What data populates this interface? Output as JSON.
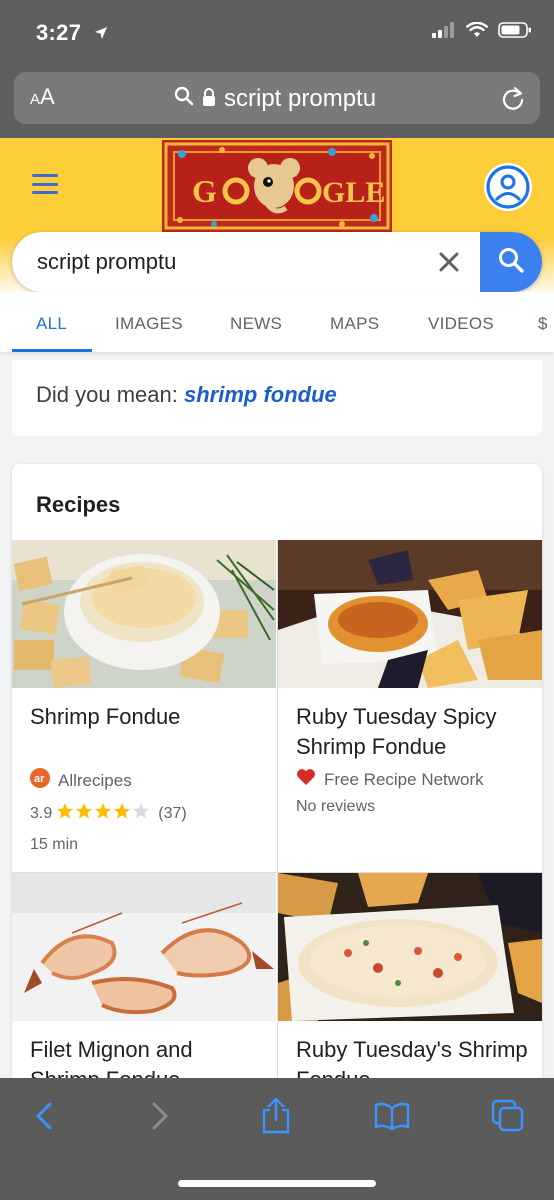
{
  "status_bar": {
    "time": "3:27"
  },
  "browser": {
    "aa_label_small": "A",
    "aa_label_large": "A",
    "url": "script promptu"
  },
  "search": {
    "query": "script promptu",
    "tabs": [
      "ALL",
      "IMAGES",
      "NEWS",
      "MAPS",
      "VIDEOS",
      "$"
    ],
    "active_tab": "ALL"
  },
  "did_you_mean": {
    "prefix": "Did you mean:",
    "suggestion": "shrimp fondue"
  },
  "recipes": {
    "title": "Recipes",
    "items": [
      {
        "name": "Shrimp Fondue",
        "source": "Allrecipes",
        "rating": "3.9",
        "stars": 3.9,
        "reviews": "(37)",
        "time": "15 min"
      },
      {
        "name": "Ruby Tuesday Spicy Shrimp Fondue",
        "source": "Free Recipe Network",
        "reviews_text": "No reviews"
      },
      {
        "name": "Filet Mignon and Shrimp Fondue"
      },
      {
        "name": "Ruby Tuesday's Shrimp Fondue"
      }
    ]
  },
  "colors": {
    "google_blue": "#1a73e8",
    "header_yellow": "#fdcd3a",
    "star_gold": "#fbbc04",
    "ios_toolbar": "#5b5b5b"
  }
}
